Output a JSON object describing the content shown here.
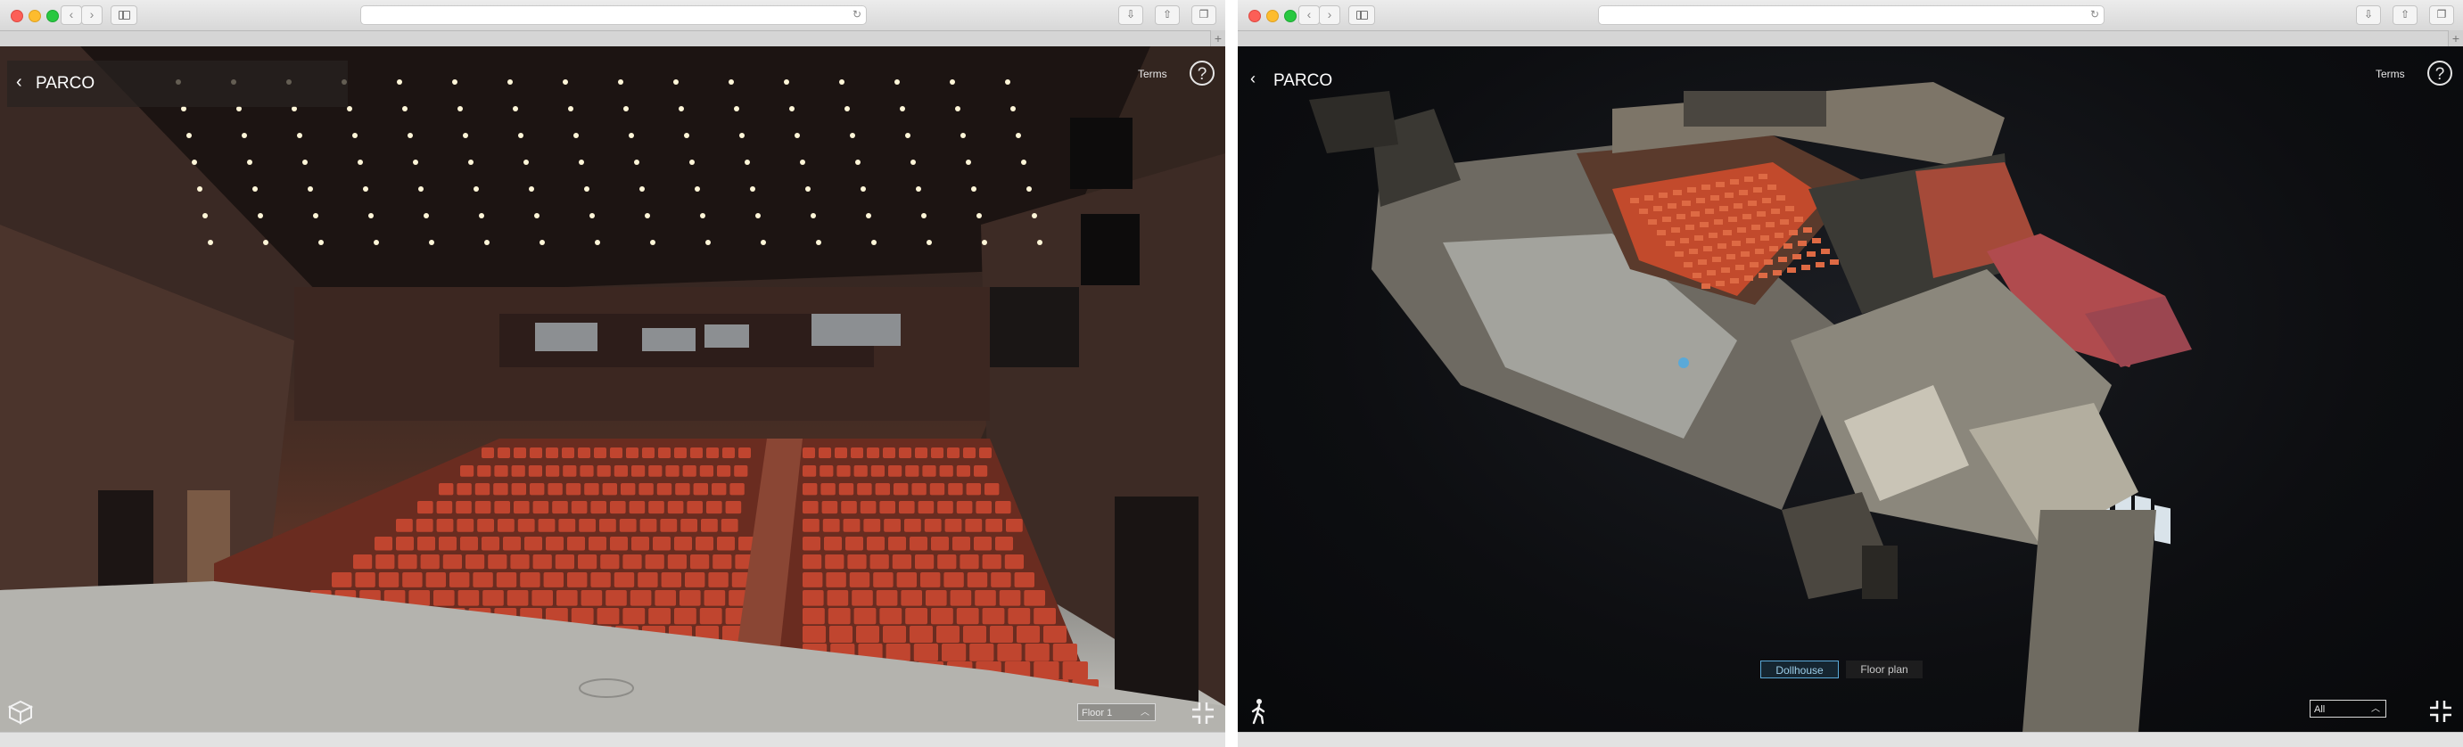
{
  "browser_left": {
    "address": ""
  },
  "browser_right": {
    "address": ""
  },
  "left_tour": {
    "title": "PARCO",
    "terms": "Terms",
    "help": "?",
    "floor_select": "Floor 1",
    "icons": [
      "back-chevron-icon",
      "help-icon",
      "dollhouse-cube-icon",
      "fullscreen-exit-icon"
    ]
  },
  "right_tour": {
    "title": "PARCO",
    "terms": "Terms",
    "help": "?",
    "mode_dollhouse": "Dollhouse",
    "mode_floorplan": "Floor plan",
    "floor_select": "All",
    "icons": [
      "back-chevron-icon",
      "help-icon",
      "walk-person-icon",
      "fullscreen-exit-icon"
    ]
  },
  "colors": {
    "seat_red": "#c0452f",
    "dollhouse_accent": "#5aa9d8",
    "ui_overlay": "#282220"
  }
}
